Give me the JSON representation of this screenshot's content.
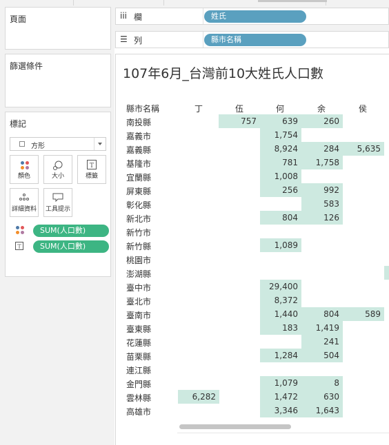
{
  "left_panel": {
    "pages_title": "頁面",
    "filters_title": "篩選條件",
    "marks": {
      "title": "標記",
      "mark_type": "方形",
      "buttons": {
        "color": "顏色",
        "size": "大小",
        "label": "標籤",
        "detail": "詳細資料",
        "tooltip": "工具提示"
      },
      "fields": [
        {
          "name": "SUM(人口數)",
          "encoding": "color"
        },
        {
          "name": "SUM(人口數)",
          "encoding": "label"
        }
      ]
    }
  },
  "shelves": {
    "columns": {
      "label": "欄",
      "icon": "iii",
      "pill": "姓氏"
    },
    "rows": {
      "label": "列",
      "icon": "☰",
      "pill": "縣市名稱"
    }
  },
  "view": {
    "title": "107年6月_台灣前10大姓氏人口數",
    "row_header": "縣市名稱",
    "columns": [
      "丁",
      "伍",
      "何",
      "余",
      "侯"
    ],
    "rows": [
      {
        "county": "南投縣",
        "values": [
          "",
          "757",
          "639",
          "260",
          ""
        ]
      },
      {
        "county": "嘉義市",
        "values": [
          "",
          "",
          "1,754",
          "",
          ""
        ]
      },
      {
        "county": "嘉義縣",
        "values": [
          "",
          "",
          "8,924",
          "284",
          "5,635"
        ]
      },
      {
        "county": "基隆市",
        "values": [
          "",
          "",
          "781",
          "1,758",
          ""
        ]
      },
      {
        "county": "宜蘭縣",
        "values": [
          "",
          "",
          "1,008",
          "",
          ""
        ]
      },
      {
        "county": "屏東縣",
        "values": [
          "",
          "",
          "256",
          "992",
          ""
        ]
      },
      {
        "county": "彰化縣",
        "values": [
          "",
          "",
          "",
          "583",
          ""
        ]
      },
      {
        "county": "新北市",
        "values": [
          "",
          "",
          "804",
          "126",
          ""
        ]
      },
      {
        "county": "新竹市",
        "values": [
          "",
          "",
          "",
          "",
          ""
        ]
      },
      {
        "county": "新竹縣",
        "values": [
          "",
          "",
          "1,089",
          "",
          ""
        ]
      },
      {
        "county": "桃園市",
        "values": [
          "",
          "",
          "",
          "",
          ""
        ]
      },
      {
        "county": "澎湖縣",
        "values": [
          "",
          "",
          "",
          "",
          ""
        ]
      },
      {
        "county": "臺中市",
        "values": [
          "",
          "",
          "29,400",
          "",
          ""
        ]
      },
      {
        "county": "臺北市",
        "values": [
          "",
          "",
          "8,372",
          "",
          ""
        ]
      },
      {
        "county": "臺南市",
        "values": [
          "",
          "",
          "1,440",
          "804",
          "589"
        ]
      },
      {
        "county": "臺東縣",
        "values": [
          "",
          "",
          "183",
          "1,419",
          ""
        ]
      },
      {
        "county": "花蓮縣",
        "values": [
          "",
          "",
          "",
          "241",
          ""
        ]
      },
      {
        "county": "苗栗縣",
        "values": [
          "",
          "",
          "1,284",
          "504",
          ""
        ]
      },
      {
        "county": "連江縣",
        "values": [
          "",
          "",
          "",
          "",
          ""
        ]
      },
      {
        "county": "金門縣",
        "values": [
          "",
          "",
          "1,079",
          "8",
          ""
        ]
      },
      {
        "county": "雲林縣",
        "values": [
          "6,282",
          "",
          "1,472",
          "630",
          ""
        ]
      },
      {
        "county": "高雄市",
        "values": [
          "",
          "",
          "3,346",
          "1,643",
          ""
        ]
      }
    ]
  },
  "colors": {
    "dimension_pill": "#5aa0bf",
    "measure_pill": "#3db583",
    "cell_fill": "#cde9e0"
  }
}
